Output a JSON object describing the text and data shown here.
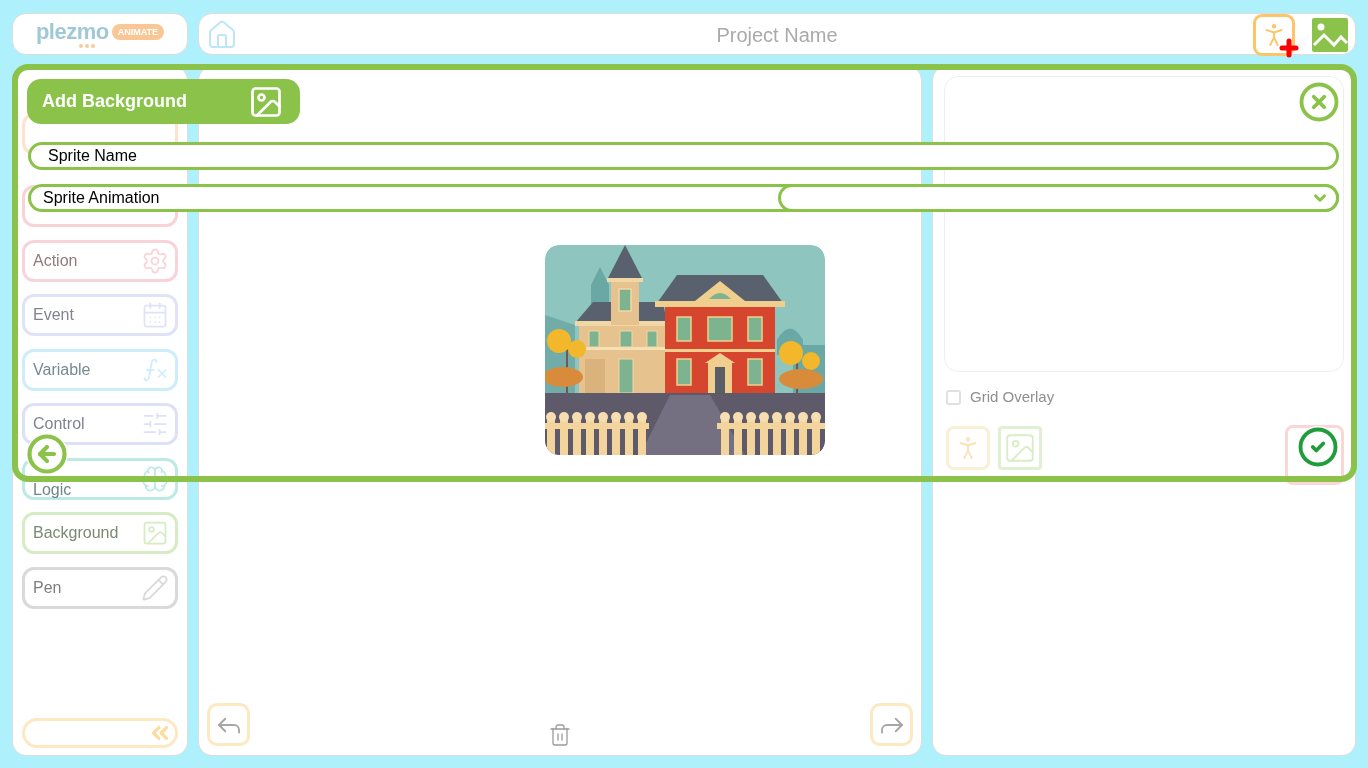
{
  "logo": {
    "name": "plezmo",
    "badge": "ANIMATE"
  },
  "header": {
    "title": "Project Name"
  },
  "sidebar": {
    "items": [
      {
        "color": "#fde2cc"
      },
      {
        "color": "#f9d2d6"
      },
      {
        "label": "Action",
        "color": "#f8d4da"
      },
      {
        "label": "Event",
        "color": "#e0e3f8"
      },
      {
        "label": "Variable",
        "color": "#cdedfa"
      },
      {
        "label": "Control",
        "color": "#dde1f7"
      },
      {
        "label": "Logic",
        "color": "#bdeae4"
      },
      {
        "label": "Background",
        "color": "#d6ecc4"
      },
      {
        "label": "Pen",
        "color": "#d9d9d9"
      }
    ]
  },
  "right_panel": {
    "grid_overlay": {
      "label": "Grid Overlay",
      "checked": false
    }
  },
  "modal": {
    "title": "Add Background",
    "fields": [
      {
        "kind": "text",
        "placeholder": "Sprite Name"
      },
      {
        "kind": "select",
        "label": "Sprite Animation"
      }
    ]
  }
}
